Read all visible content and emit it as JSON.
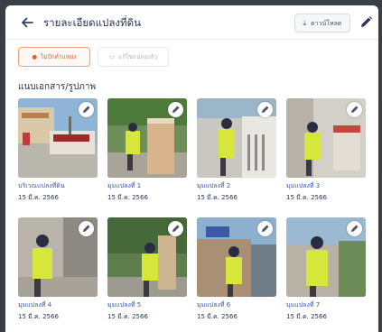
{
  "header": {
    "title": "รายละเอียดแปลงที่ดิน",
    "download_label": "ดาวน์โหลด"
  },
  "tabs": [
    {
      "label": "ไม่ปักตำแหน่ง",
      "active": true
    },
    {
      "label": "แก้ไขแปลงแล้ว",
      "active": false
    }
  ],
  "section": {
    "title": "แนบเอกสาร/รูปภาพ"
  },
  "photos": [
    {
      "caption": "บริเวณแปลงที่ดิน",
      "date": "15 มี.ค. 2566"
    },
    {
      "caption": "มุมแปลงที่ 1",
      "date": "15 มี.ค. 2566"
    },
    {
      "caption": "มุมแปลงที่ 2",
      "date": "15 มี.ค. 2566"
    },
    {
      "caption": "มุมแปลงที่ 3",
      "date": "15 มี.ค. 2566"
    },
    {
      "caption": "มุมแปลงที่ 4",
      "date": "15 มี.ค. 2566"
    },
    {
      "caption": "มุมแปลงที่ 5",
      "date": "15 มี.ค. 2566"
    },
    {
      "caption": "มุมแปลงที่ 6",
      "date": "15 มี.ค. 2566"
    },
    {
      "caption": "มุมแปลงที่ 7",
      "date": "15 มี.ค. 2566"
    }
  ],
  "icons": {
    "back": "arrow-left-icon",
    "download": "download-icon",
    "edit": "pencil-icon",
    "pin": "map-pin-icon",
    "map": "map-icon"
  },
  "colors": {
    "accent": "#e0662f",
    "title": "#2c3656",
    "caption_link": "#3a56a8"
  }
}
